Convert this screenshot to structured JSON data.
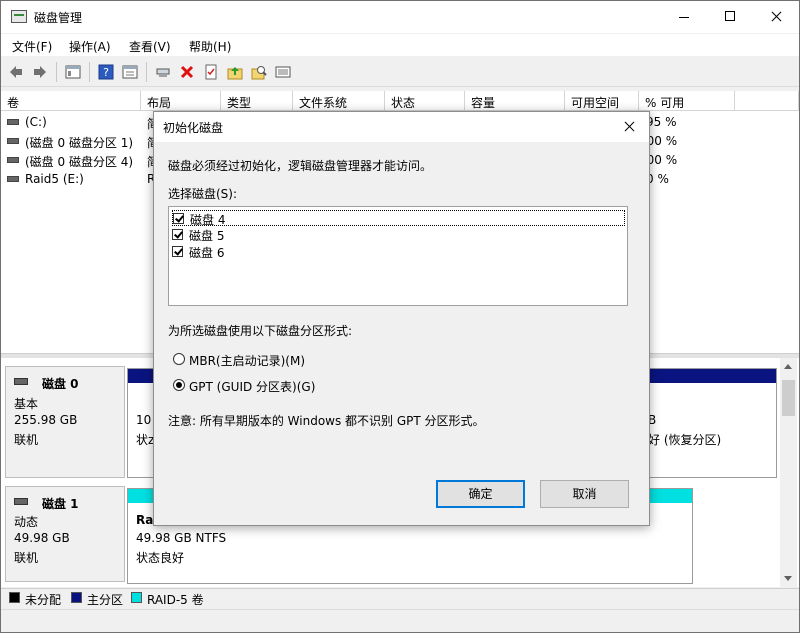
{
  "window": {
    "title": "磁盘管理"
  },
  "menu": [
    "文件(F)",
    "操作(A)",
    "查看(V)",
    "帮助(H)"
  ],
  "toolbar": {
    "icons": [
      "back-arrow-icon",
      "forward-arrow-icon",
      "console-tree-icon",
      "help-icon",
      "properties-icon",
      "connect-icon",
      "delete-icon",
      "checklist-icon",
      "up-folder-icon",
      "search-folder-icon",
      "list-view-icon"
    ],
    "delete_color": "#e01010"
  },
  "list": {
    "columns": [
      "卷",
      "布局",
      "类型",
      "文件系统",
      "状态",
      "容量",
      "可用空间",
      "% 可用"
    ],
    "rows": [
      {
        "name": "(C:)",
        "layout": "简",
        "pct": "95 %"
      },
      {
        "name": "(磁盘 0 磁盘分区 1)",
        "layout": "简",
        "pct": "100 %"
      },
      {
        "name": "(磁盘 0 磁盘分区 4)",
        "layout": "简",
        "pct": "100 %"
      },
      {
        "name": "Raid5 (E:)",
        "layout": "R",
        "pct": "0 %"
      }
    ]
  },
  "disks": [
    {
      "name": "磁盘 0",
      "type": "基本",
      "size": "255.98 GB",
      "status": "联机",
      "vol_left_line1": "10",
      "vol_left_line2": "状z",
      "vol_right_line1": "B",
      "vol_right_line2": "好 (恢复分区)"
    },
    {
      "name": "磁盘 1",
      "type": "动态",
      "size": "49.98 GB",
      "status": "联机",
      "vol_title": "Raid5 (E:)",
      "vol_line1": "49.98 GB NTFS",
      "vol_line2": "状态良好"
    }
  ],
  "legend": [
    {
      "label": "未分配",
      "color": "#000000"
    },
    {
      "label": "主分区",
      "color": "#0a1480"
    },
    {
      "label": "RAID-5 卷",
      "color": "#00e0e0"
    }
  ],
  "dialog": {
    "title": "初始化磁盘",
    "intro": "磁盘必须经过初始化，逻辑磁盘管理器才能访问。",
    "select_label": "选择磁盘(S):",
    "disks": [
      {
        "label": "磁盘 4",
        "checked": true
      },
      {
        "label": "磁盘 5",
        "checked": true
      },
      {
        "label": "磁盘 6",
        "checked": true
      }
    ],
    "partition_label": "为所选磁盘使用以下磁盘分区形式:",
    "options": [
      {
        "label": "MBR(主启动记录)(M)",
        "selected": false
      },
      {
        "label": "GPT (GUID 分区表)(G)",
        "selected": true
      }
    ],
    "note": "注意: 所有早期版本的 Windows 都不识别 GPT 分区形式。",
    "ok": "确定",
    "cancel": "取消",
    "accent": "#0078d7"
  }
}
